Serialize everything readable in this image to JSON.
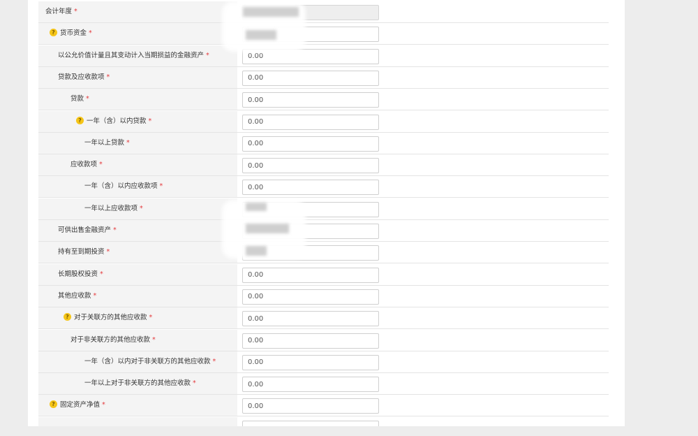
{
  "rows": [
    {
      "label": "会计年度",
      "required": "*",
      "help": false,
      "value": "",
      "disabled": true
    },
    {
      "label": "货币资金",
      "required": "*",
      "help": true,
      "value": "",
      "disabled": false
    },
    {
      "label": "以公允价值计量且其变动计入当期损益的金融资产",
      "required": "*",
      "help": false,
      "value": "0.00",
      "disabled": false
    },
    {
      "label": "贷款及应收款项",
      "required": "*",
      "help": false,
      "value": "0.00",
      "disabled": false
    },
    {
      "label": "贷款",
      "required": "*",
      "help": false,
      "value": "0.00",
      "disabled": false
    },
    {
      "label": "一年（含）以内贷款",
      "required": "*",
      "help": true,
      "value": "0.00",
      "disabled": false
    },
    {
      "label": "一年以上贷款",
      "required": "*",
      "help": false,
      "value": "0.00",
      "disabled": false
    },
    {
      "label": "应收款项",
      "required": "*",
      "help": false,
      "value": "0.00",
      "disabled": false
    },
    {
      "label": "一年（含）以内应收款项",
      "required": "*",
      "help": false,
      "value": "0.00",
      "disabled": false
    },
    {
      "label": "一年以上应收款项",
      "required": "*",
      "help": false,
      "value": "",
      "disabled": false
    },
    {
      "label": "可供出售金融资产",
      "required": "*",
      "help": false,
      "value": "",
      "disabled": false
    },
    {
      "label": "持有至到期投资",
      "required": "*",
      "help": false,
      "value": "",
      "disabled": false
    },
    {
      "label": "长期股权投资",
      "required": "*",
      "help": false,
      "value": "0.00",
      "disabled": false
    },
    {
      "label": "其他应收款",
      "required": "*",
      "help": false,
      "value": "0.00",
      "disabled": false
    },
    {
      "label": "对于关联方的其他应收款",
      "required": "*",
      "help": true,
      "value": "0.00",
      "disabled": false
    },
    {
      "label": "对于非关联方的其他应收款",
      "required": "*",
      "help": false,
      "value": "0.00",
      "disabled": false
    },
    {
      "label": "一年（含）以内对于非关联方的其他应收款",
      "required": "*",
      "help": false,
      "value": "0.00",
      "disabled": false
    },
    {
      "label": "一年以上对于非关联方的其他应收款",
      "required": "*",
      "help": false,
      "value": "0.00",
      "disabled": false
    },
    {
      "label": "固定资产净值",
      "required": "*",
      "help": true,
      "value": "0.00",
      "disabled": false
    },
    {
      "label": "",
      "required": "",
      "help": false,
      "value": "",
      "disabled": false
    }
  ],
  "icons": {
    "help": "question-icon",
    "scroll_up": "triangle-up-icon",
    "scroll_down": "triangle-down-icon"
  },
  "help_glyph": "?",
  "scroll_up_glyph": "▲",
  "scroll_down_glyph": "▼",
  "colors": {
    "required": "#e4393c",
    "help": "#f5c518",
    "label_bg": "#f4f4f4"
  }
}
